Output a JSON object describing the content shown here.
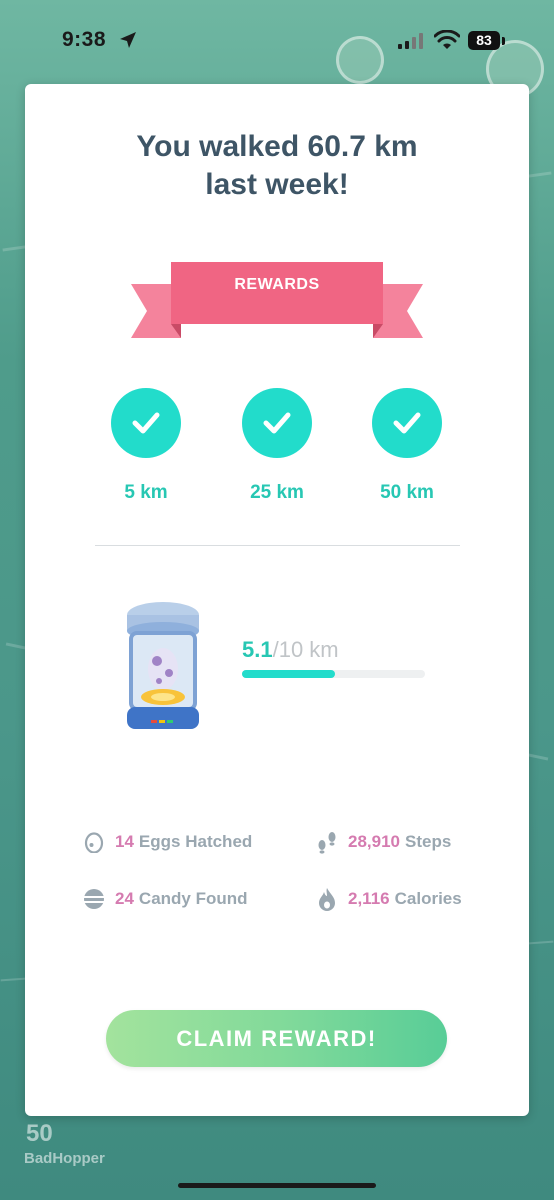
{
  "status_bar": {
    "time": "9:38",
    "battery": "83"
  },
  "colors": {
    "accent": "#22dccb",
    "accent_text": "#27c7b3",
    "ribbon": "#f06583",
    "stat_number": "#d57bb0",
    "title": "#3e5566"
  },
  "card": {
    "title_line1": "You walked 60.7 km",
    "title_line2": "last week!",
    "ribbon_label": "REWARDS",
    "milestones": [
      {
        "label": "5 km",
        "icon": "check-icon",
        "completed": true
      },
      {
        "label": "25 km",
        "icon": "check-icon",
        "completed": true
      },
      {
        "label": "50 km",
        "icon": "check-icon",
        "completed": true
      }
    ],
    "incubator": {
      "icon": "egg-incubator-icon",
      "current": "5.1",
      "total": "/10 km",
      "progress_fraction": 0.51
    },
    "stats": [
      {
        "icon": "egg-icon",
        "number": "14",
        "label": "Eggs Hatched"
      },
      {
        "icon": "footprints-icon",
        "number": "28,910",
        "label": "Steps"
      },
      {
        "icon": "candy-icon",
        "number": "24",
        "label": "Candy Found"
      },
      {
        "icon": "flame-icon",
        "number": "2,116",
        "label": "Calories"
      }
    ],
    "claim_button": "CLAIM REWARD!"
  },
  "background": {
    "trainer_level": "50",
    "trainer_name": "BadHopper"
  }
}
